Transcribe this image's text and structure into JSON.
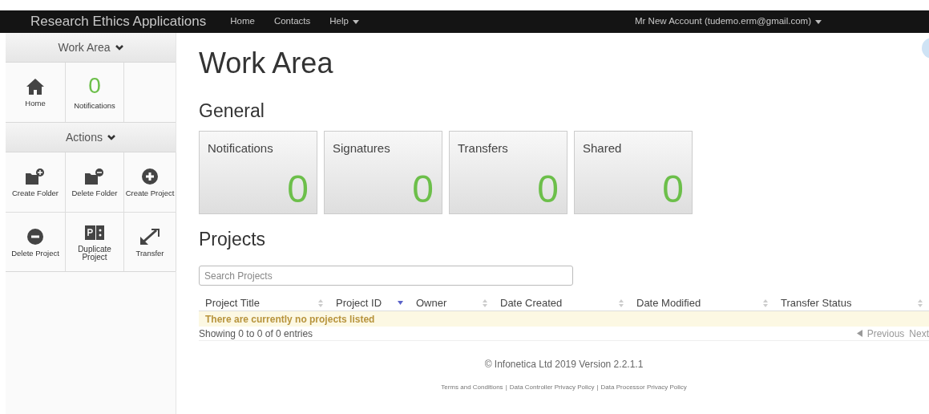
{
  "navbar": {
    "brand": "Research Ethics Applications",
    "links": [
      {
        "label": "Home",
        "dropdown": false
      },
      {
        "label": "Contacts",
        "dropdown": false
      },
      {
        "label": "Help",
        "dropdown": true
      }
    ],
    "account": "Mr New Account (tudemo.erm@gmail.com)"
  },
  "sidebar": {
    "sections": [
      {
        "title": "Work Area",
        "expanded": true,
        "items": [
          {
            "kind": "home",
            "label": "Home"
          },
          {
            "kind": "count",
            "count": "0",
            "label": "Notifications"
          }
        ]
      },
      {
        "title": "Actions",
        "expanded": true,
        "items": [
          {
            "kind": "folder-plus",
            "label": "Create Folder"
          },
          {
            "kind": "folder-minus",
            "label": "Delete Folder"
          },
          {
            "kind": "circle-plus",
            "label": "Create Project"
          },
          {
            "kind": "circle-minus",
            "label": "Delete Project"
          },
          {
            "kind": "duplicate",
            "label": "Duplicate Project"
          },
          {
            "kind": "transfer",
            "label": "Transfer"
          }
        ]
      }
    ]
  },
  "page_title": "Work Area",
  "general": {
    "heading": "General",
    "tiles": [
      {
        "label": "Notifications",
        "count": "0"
      },
      {
        "label": "Signatures",
        "count": "0"
      },
      {
        "label": "Transfers",
        "count": "0"
      },
      {
        "label": "Shared",
        "count": "0"
      }
    ]
  },
  "projects": {
    "heading": "Projects",
    "search": {
      "placeholder": "Search Projects"
    },
    "columns": [
      {
        "label": "Project Title",
        "sorted": false
      },
      {
        "label": "Project ID",
        "sorted": true
      },
      {
        "label": "Owner",
        "sorted": false
      },
      {
        "label": "Date Created",
        "sorted": false
      },
      {
        "label": "Date Modified",
        "sorted": false
      },
      {
        "label": "Transfer Status",
        "sorted": false
      }
    ],
    "empty_message": "There are currently no projects listed",
    "info": "Showing 0 to 0 of 0 entries",
    "pagination": [
      "Previous",
      "Next"
    ]
  },
  "footer": {
    "copyright": "© Infonetica Ltd 2019 Version 2.2.1.1",
    "links": [
      "Terms and Conditions",
      "Data Controller Privacy Policy",
      "Data Processor Privacy Policy"
    ],
    "separator": "|"
  }
}
